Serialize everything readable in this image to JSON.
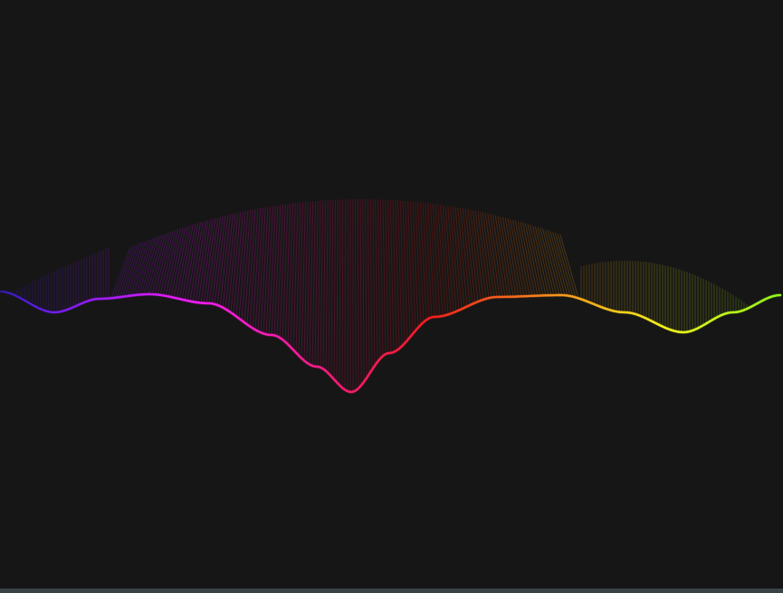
{
  "canvas": {
    "background": "#161616",
    "bottom_strip_color": "#3a4246"
  },
  "artwork": {
    "kind": "rainbow string-art wave",
    "colors": {
      "start": "#2a1aff",
      "middle": "#e0203a",
      "end": "#1fbf9a"
    }
  }
}
